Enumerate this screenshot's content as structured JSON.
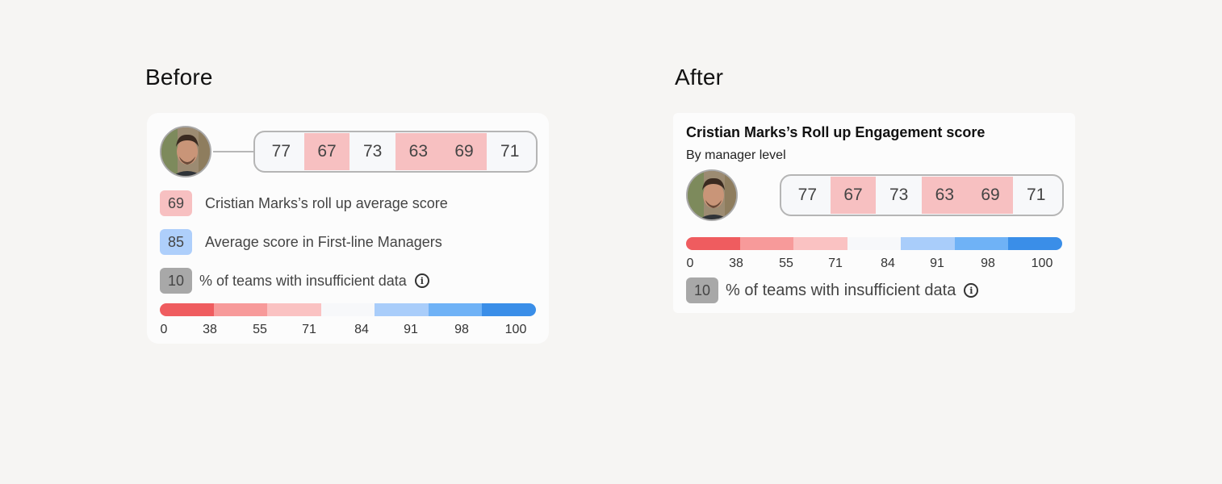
{
  "before": {
    "heading": "Before",
    "scores": [
      {
        "value": "77",
        "low": false
      },
      {
        "value": "67",
        "low": true
      },
      {
        "value": "73",
        "low": false
      },
      {
        "value": "63",
        "low": true
      },
      {
        "value": "69",
        "low": true
      },
      {
        "value": "71",
        "low": false
      }
    ],
    "legend": [
      {
        "badge": "69",
        "text": "Cristian Marks’s roll up average score",
        "color": "#f7c0c1"
      },
      {
        "badge": "85",
        "text": "Average score in First-line Managers",
        "color": "#aecffb"
      },
      {
        "badge": "10",
        "text": "% of teams with insufficient data",
        "color": "#a8a8a8"
      }
    ]
  },
  "after": {
    "heading": "After",
    "title": "Cristian Marks’s Roll up Engagement score",
    "subtitle": "By manager level",
    "scores": [
      {
        "value": "77",
        "low": false
      },
      {
        "value": "67",
        "low": true
      },
      {
        "value": "73",
        "low": false
      },
      {
        "value": "63",
        "low": true
      },
      {
        "value": "69",
        "low": true
      },
      {
        "value": "71",
        "low": false
      }
    ],
    "insufficient": {
      "badge": "10",
      "text": "% of teams with insufficient data",
      "color": "#a8a8a8"
    }
  },
  "scale": {
    "labels": [
      "0",
      "38",
      "55",
      "71",
      "84",
      "91",
      "98",
      "100"
    ],
    "colors": [
      "#ef5c5f",
      "#f79a9a",
      "#fac2c2",
      "#f7f8fa",
      "#a9cdfa",
      "#6fb2f6",
      "#3a8ee8"
    ]
  },
  "icons": {
    "info": "info-icon",
    "avatar": "avatar-photo"
  }
}
